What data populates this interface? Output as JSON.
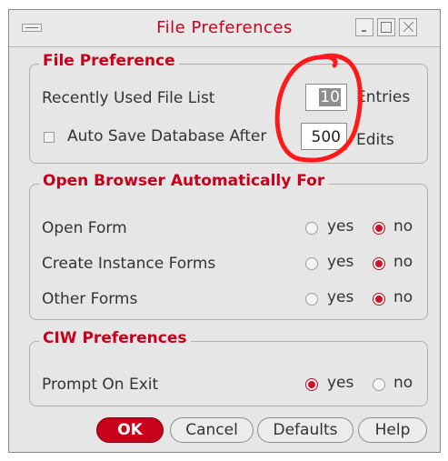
{
  "window": {
    "title": "File Preferences"
  },
  "file_preference": {
    "heading": "File Preference",
    "recent_label": "Recently Used File List",
    "recent_value": "10",
    "recent_unit": "Entries",
    "autosave_label": "Auto Save Database After",
    "autosave_checked": false,
    "autosave_value": "500",
    "autosave_unit": "Edits"
  },
  "open_browser": {
    "heading": "Open Browser Automatically For",
    "rows": [
      {
        "label": "Open Form",
        "selected": "no"
      },
      {
        "label": "Create Instance Forms",
        "selected": "no"
      },
      {
        "label": "Other Forms",
        "selected": "no"
      }
    ],
    "yes_label": "yes",
    "no_label": "no"
  },
  "ciw": {
    "heading": "CIW Preferences",
    "rows": [
      {
        "label": "Prompt On Exit",
        "selected": "yes"
      }
    ],
    "yes_label": "yes",
    "no_label": "no"
  },
  "buttons": {
    "ok": "OK",
    "cancel": "Cancel",
    "defaults": "Defaults",
    "help": "Help"
  },
  "colors": {
    "accent": "#c8001b",
    "annotation": "#ff1a1a"
  },
  "icons": [
    "window-menu-icon",
    "minimize-icon",
    "maximize-icon",
    "close-icon"
  ]
}
